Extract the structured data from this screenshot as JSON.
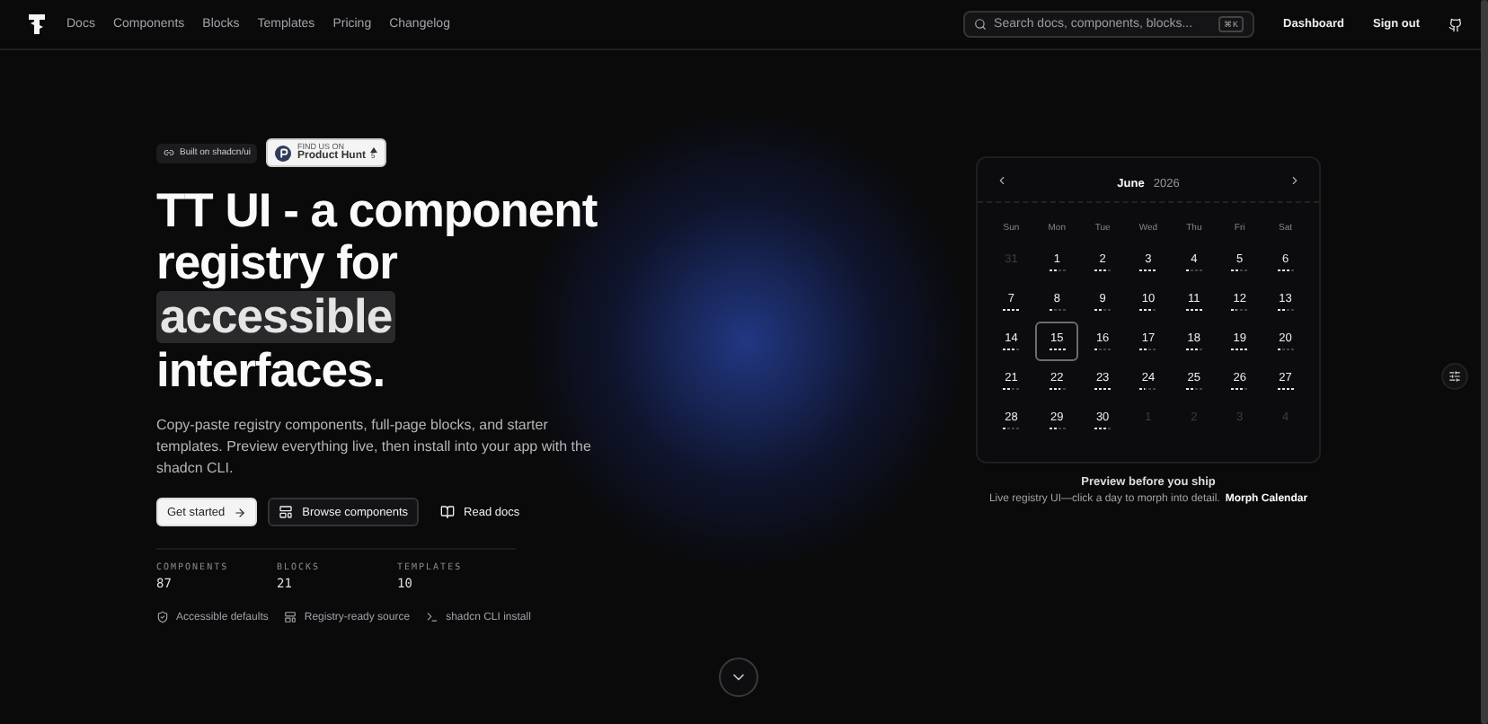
{
  "nav": {
    "links": [
      "Docs",
      "Components",
      "Blocks",
      "Templates",
      "Pricing",
      "Changelog"
    ],
    "search": {
      "placeholder": "Search docs, components, blocks...",
      "shortcut": "⌘K"
    },
    "actions": [
      "Dashboard",
      "Sign out"
    ]
  },
  "hero": {
    "badges": [
      {
        "kind": "plain",
        "label": "Built on shadcn/ui"
      },
      {
        "kind": "producthunt",
        "caption": "FIND US ON",
        "label": "Product Hunt",
        "count": "5"
      }
    ],
    "title_lines": [
      {
        "text": "TT UI - a component",
        "highlight": false
      },
      {
        "text": "registry for",
        "highlight": false
      },
      {
        "text": "accessible",
        "highlight": true
      },
      {
        "text": "interfaces.",
        "highlight": false
      }
    ],
    "description": "Copy-paste registry components, full-page blocks, and starter templates. Preview everything live, then install into your app with the shadcn CLI.",
    "buttons": [
      {
        "kind": "primary",
        "label": "Get started"
      },
      {
        "kind": "outline",
        "label": "Browse components"
      },
      {
        "kind": "ghost",
        "label": "Read docs"
      }
    ],
    "stats": [
      {
        "label": "COMPONENTS",
        "value": "87"
      },
      {
        "label": "BLOCKS",
        "value": "21"
      },
      {
        "label": "TEMPLATES",
        "value": "10"
      }
    ],
    "features": [
      {
        "kind": "shield",
        "label": "Accessible defaults"
      },
      {
        "kind": "registry",
        "label": "Registry-ready source"
      },
      {
        "kind": "terminal",
        "label": "shadcn CLI install"
      }
    ]
  },
  "calendar": {
    "month": "June",
    "year": "2026",
    "weekdays": [
      "Sun",
      "Mon",
      "Tue",
      "Wed",
      "Thu",
      "Fri",
      "Sat"
    ],
    "days": [
      {
        "label": "31",
        "outside": true,
        "selected": false
      },
      {
        "label": "1",
        "outside": false,
        "selected": false,
        "level": 0.5
      },
      {
        "label": "2",
        "outside": false,
        "selected": false,
        "level": 0.75
      },
      {
        "label": "3",
        "outside": false,
        "selected": false,
        "level": 1
      },
      {
        "label": "4",
        "outside": false,
        "selected": false,
        "level": 0.25
      },
      {
        "label": "5",
        "outside": false,
        "selected": false,
        "level": 0.5
      },
      {
        "label": "6",
        "outside": false,
        "selected": false,
        "level": 0.75
      },
      {
        "label": "7",
        "outside": false,
        "selected": false,
        "level": 1
      },
      {
        "label": "8",
        "outside": false,
        "selected": false,
        "level": 0.25
      },
      {
        "label": "9",
        "outside": false,
        "selected": false,
        "level": 0.5
      },
      {
        "label": "10",
        "outside": false,
        "selected": false,
        "level": 0.75
      },
      {
        "label": "11",
        "outside": false,
        "selected": false,
        "level": 1
      },
      {
        "label": "12",
        "outside": false,
        "selected": false,
        "level": 0.25
      },
      {
        "label": "13",
        "outside": false,
        "selected": false,
        "level": 0.5
      },
      {
        "label": "14",
        "outside": false,
        "selected": false,
        "level": 0.75
      },
      {
        "label": "15",
        "outside": false,
        "selected": true,
        "level": 1
      },
      {
        "label": "16",
        "outside": false,
        "selected": false,
        "level": 0.25
      },
      {
        "label": "17",
        "outside": false,
        "selected": false,
        "level": 0.5
      },
      {
        "label": "18",
        "outside": false,
        "selected": false,
        "level": 0.75
      },
      {
        "label": "19",
        "outside": false,
        "selected": false,
        "level": 1
      },
      {
        "label": "20",
        "outside": false,
        "selected": false,
        "level": 0.25
      },
      {
        "label": "21",
        "outside": false,
        "selected": false,
        "level": 0.5
      },
      {
        "label": "22",
        "outside": false,
        "selected": false,
        "level": 0.75
      },
      {
        "label": "23",
        "outside": false,
        "selected": false,
        "level": 1
      },
      {
        "label": "24",
        "outside": false,
        "selected": false,
        "level": 0.25
      },
      {
        "label": "25",
        "outside": false,
        "selected": false,
        "level": 0.5
      },
      {
        "label": "26",
        "outside": false,
        "selected": false,
        "level": 0.75
      },
      {
        "label": "27",
        "outside": false,
        "selected": false,
        "level": 1
      },
      {
        "label": "28",
        "outside": false,
        "selected": false,
        "level": 0.25
      },
      {
        "label": "29",
        "outside": false,
        "selected": false,
        "level": 0.5
      },
      {
        "label": "30",
        "outside": false,
        "selected": false,
        "level": 0.75
      },
      {
        "label": "1",
        "outside": true,
        "selected": false
      },
      {
        "label": "2",
        "outside": true,
        "selected": false
      },
      {
        "label": "3",
        "outside": true,
        "selected": false
      },
      {
        "label": "4",
        "outside": true,
        "selected": false
      }
    ],
    "caption_title": "Preview before you ship",
    "caption_text": "Live registry UI—click a day to morph into detail.",
    "caption_link": "Morph Calendar"
  }
}
